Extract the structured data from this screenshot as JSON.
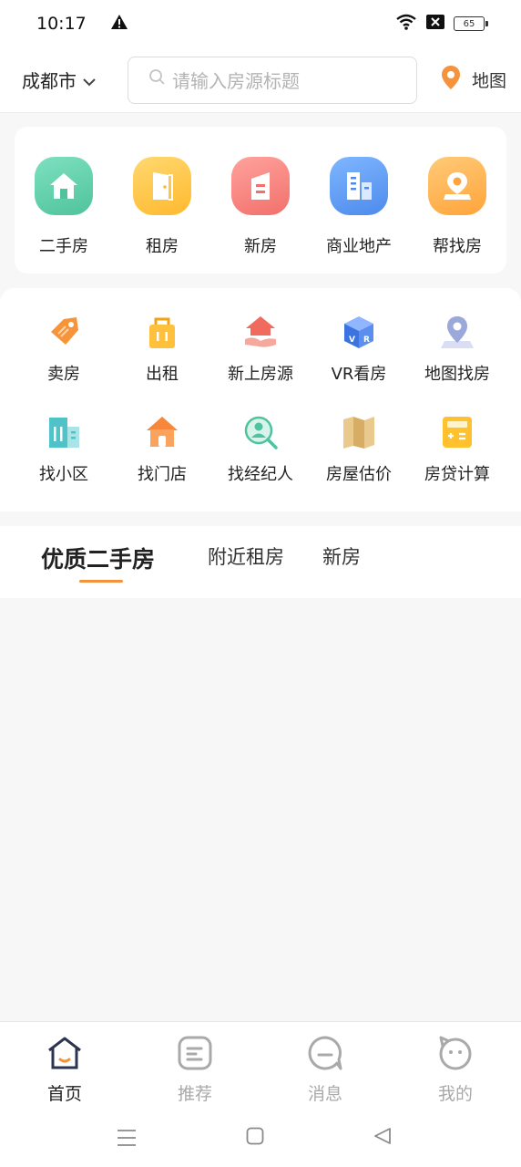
{
  "status_bar": {
    "time": "10:17",
    "battery": "65",
    "icons": [
      "warning-icon",
      "wifi-icon",
      "no-sim-icon",
      "battery-icon"
    ]
  },
  "header": {
    "city": "成都市",
    "search_placeholder": "请输入房源标题",
    "map_label": "地图"
  },
  "main_categories": [
    {
      "label": "二手房",
      "icon": "house-icon",
      "color": "#5fcfab"
    },
    {
      "label": "租房",
      "icon": "door-icon",
      "color": "#ffc548"
    },
    {
      "label": "新房",
      "icon": "building-icon",
      "color": "#f9827d"
    },
    {
      "label": "商业地产",
      "icon": "office-tower-icon",
      "color": "#5b9cf4"
    },
    {
      "label": "帮找房",
      "icon": "location-person-icon",
      "color": "#ffb354"
    }
  ],
  "tools": [
    {
      "label": "卖房",
      "icon": "price-tag-icon"
    },
    {
      "label": "出租",
      "icon": "shopping-bag-icon"
    },
    {
      "label": "新上房源",
      "icon": "house-hand-icon"
    },
    {
      "label": "VR看房",
      "icon": "vr-cube-icon"
    },
    {
      "label": "地图找房",
      "icon": "map-pin-icon"
    },
    {
      "label": "找小区",
      "icon": "community-icon"
    },
    {
      "label": "找门店",
      "icon": "store-icon"
    },
    {
      "label": "找经纪人",
      "icon": "agent-search-icon"
    },
    {
      "label": "房屋估价",
      "icon": "folded-map-icon"
    },
    {
      "label": "房贷计算",
      "icon": "calculator-icon"
    }
  ],
  "tabs": [
    {
      "label": "优质二手房",
      "active": true
    },
    {
      "label": "附近租房",
      "active": false
    },
    {
      "label": "新房",
      "active": false
    }
  ],
  "bottom_nav": [
    {
      "label": "首页",
      "icon": "home-icon",
      "active": true
    },
    {
      "label": "推荐",
      "icon": "recommend-icon",
      "active": false
    },
    {
      "label": "消息",
      "icon": "message-icon",
      "active": false
    },
    {
      "label": "我的",
      "icon": "profile-icon",
      "active": false
    }
  ],
  "colors": {
    "accent": "#f5923e",
    "background": "#f7f7f7"
  }
}
